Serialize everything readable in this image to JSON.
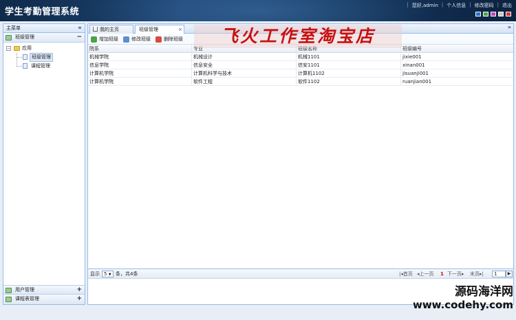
{
  "header": {
    "title": "学生考勤管理系统",
    "greeting": "您好,admin",
    "profile_link": "个人信息",
    "password_link": "修改密码",
    "logout_link": "退出",
    "theme_colors": [
      "#2d6fc2",
      "#4da24d",
      "#c545b8",
      "#c7c7c7",
      "#d83a3a"
    ]
  },
  "sidebar": {
    "title": "主菜单",
    "collapse_glyph": "«",
    "sections": [
      {
        "label": "班级管理",
        "toggle": "−"
      },
      {
        "label": "用户管理",
        "toggle": "+"
      },
      {
        "label": "课程表管理",
        "toggle": "+"
      }
    ],
    "tree": {
      "root_label": "应用",
      "root_toggle": "−",
      "children": [
        "班级管理",
        "课程管理"
      ]
    }
  },
  "tabs": [
    {
      "label": "我的主页",
      "closable": false
    },
    {
      "label": "班级管理",
      "closable": true,
      "close_glyph": "×"
    }
  ],
  "tabs_more_glyph": "»",
  "toolbar": {
    "add_label": "增加班级",
    "edit_label": "修改班级",
    "delete_label": "删除班级"
  },
  "grid": {
    "columns": [
      "院系",
      "专业",
      "班级名称",
      "班级编号"
    ],
    "rows": [
      [
        "机械学院",
        "机械设计",
        "机械1101",
        "jixie001"
      ],
      [
        "信息学院",
        "信息安全",
        "信安1101",
        "xinan001"
      ],
      [
        "计算机学院",
        "计算机科学与技术",
        "计算机1102",
        "jisuanji001"
      ],
      [
        "计算机学院",
        "软件工程",
        "软件1102",
        "ruanjian001"
      ]
    ]
  },
  "pager": {
    "show_label": "显示",
    "page_size": "5",
    "summary": "条，共4条",
    "first": "首页",
    "prev": "上一页",
    "current_page": "1",
    "next": "下一页",
    "last": "末页",
    "jump_value": "1",
    "go_glyph": "▶"
  },
  "watermarks": {
    "studio": "飞火工作室淘宝店",
    "site_name": "源码海洋网",
    "site_url": "www.codehy.com"
  }
}
